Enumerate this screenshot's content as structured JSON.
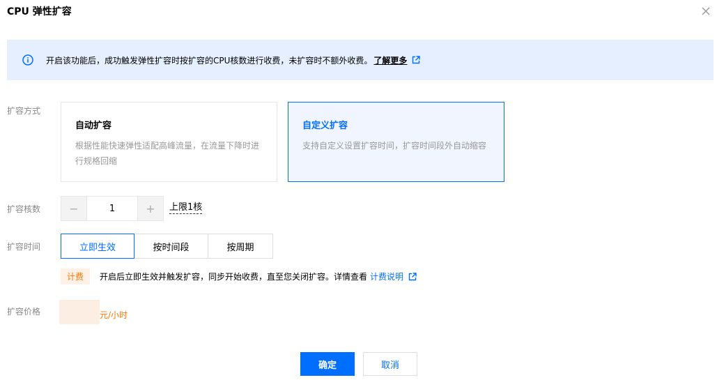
{
  "dialog": {
    "title": "CPU 弹性扩容",
    "close_icon": "close-icon"
  },
  "notice": {
    "icon": "info-icon",
    "text": "开启该功能后，成功触发弹性扩容时按扩容的CPU核数进行收费，未扩容时不额外收费。",
    "link_label": "了解更多",
    "link_icon": "external-link-icon",
    "bg_color": "#e5efff"
  },
  "scale_mode": {
    "label": "扩容方式",
    "options": [
      {
        "title": "自动扩容",
        "desc": "根据性能快速弹性适配高峰流量，在流量下降时进行规格回缩",
        "selected": false
      },
      {
        "title": "自定义扩容",
        "desc": "支持自定义设置扩容时间，扩容时间段外自动缩容",
        "selected": true
      }
    ]
  },
  "cores": {
    "label": "扩容核数",
    "value": "1",
    "minus": "−",
    "plus": "+",
    "limit_text": "上限1核"
  },
  "timing": {
    "label": "扩容时间",
    "options": [
      "立即生效",
      "按时间段",
      "按周期"
    ],
    "active_index": 0
  },
  "billing": {
    "tag": "计费",
    "text": "开启后立即生效并触发扩容，同步开始收费，直至您关闭扩容。详情查看",
    "link_label": "计费说明",
    "link_icon": "external-link-icon"
  },
  "price": {
    "label": "扩容价格",
    "unit": "元/小时"
  },
  "actions": {
    "ok_label": "确定",
    "cancel_label": "取消"
  },
  "colors": {
    "primary": "#006eff",
    "warning": "#ff7800",
    "selected_bg": "#f0f5ff"
  }
}
